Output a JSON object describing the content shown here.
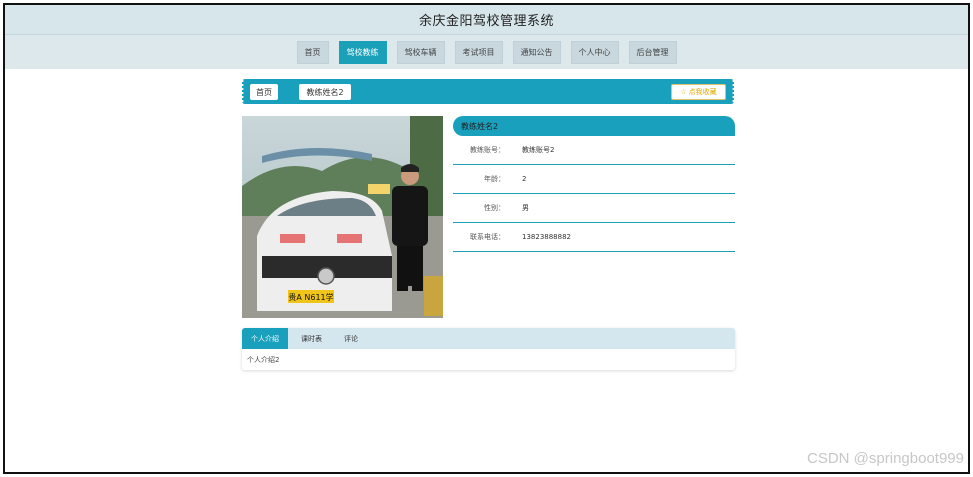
{
  "header": {
    "title": "余庆金阳驾校管理系统"
  },
  "nav": {
    "items": [
      {
        "label": "首页",
        "active": false
      },
      {
        "label": "驾校教练",
        "active": true
      },
      {
        "label": "驾校车辆",
        "active": false
      },
      {
        "label": "考试项目",
        "active": false
      },
      {
        "label": "通知公告",
        "active": false
      },
      {
        "label": "个人中心",
        "active": false
      },
      {
        "label": "后台管理",
        "active": false
      }
    ]
  },
  "breadcrumb": {
    "home": "首页",
    "current": "教练姓名2",
    "favorite_label": "点我收藏",
    "favorite_icon": "star-icon"
  },
  "profile": {
    "title": "教练姓名2",
    "fields": [
      {
        "label": "教练账号：",
        "value": "教练账号2"
      },
      {
        "label": "年龄：",
        "value": "2"
      },
      {
        "label": "性别：",
        "value": "男"
      },
      {
        "label": "联系电话：",
        "value": "13823888882"
      }
    ],
    "photo_plate": "贵A N611学"
  },
  "tabs": {
    "items": [
      {
        "label": "个人介绍",
        "active": true
      },
      {
        "label": "课时表",
        "active": false
      },
      {
        "label": "评论",
        "active": false
      }
    ],
    "content": "个人介绍2"
  },
  "watermark": "CSDN @springboot999",
  "colors": {
    "accent": "#19a0bc",
    "header_bg": "#d6e6ea",
    "favorite": "#e0a800"
  }
}
